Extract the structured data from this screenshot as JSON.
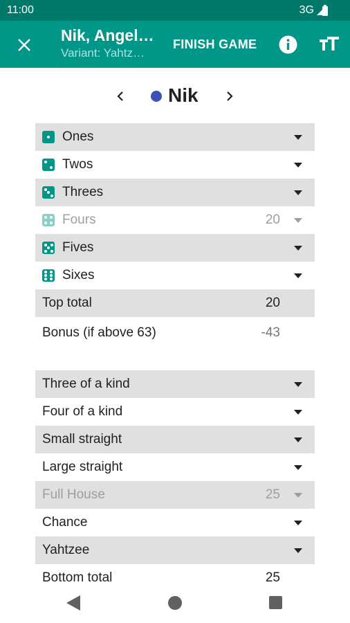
{
  "status_bar": {
    "time": "11:00",
    "network": "3G",
    "signal_icon": "signal-icon",
    "battery_icon": "battery-icon"
  },
  "app_bar": {
    "close_icon": "close-icon",
    "title": "Nik, Angel…",
    "subtitle": "Variant: Yahtz…",
    "finish_label": "FINISH GAME",
    "info_icon": "info-icon",
    "text_size_icon": "text-size-icon",
    "background": "#009688"
  },
  "player": {
    "prev_icon": "chevron-left-icon",
    "next_icon": "chevron-right-icon",
    "name": "Nik",
    "color": "#3f51b5"
  },
  "upper_section": [
    {
      "label": "Ones",
      "die": 1,
      "value": "",
      "dropdown": true,
      "disabled": false,
      "shaded": true
    },
    {
      "label": "Twos",
      "die": 2,
      "value": "",
      "dropdown": true,
      "disabled": false,
      "shaded": false
    },
    {
      "label": "Threes",
      "die": 3,
      "value": "",
      "dropdown": true,
      "disabled": false,
      "shaded": true
    },
    {
      "label": "Fours",
      "die": 4,
      "value": "20",
      "dropdown": true,
      "disabled": true,
      "shaded": false
    },
    {
      "label": "Fives",
      "die": 5,
      "value": "",
      "dropdown": true,
      "disabled": false,
      "shaded": true
    },
    {
      "label": "Sixes",
      "die": 6,
      "value": "",
      "dropdown": true,
      "disabled": false,
      "shaded": false
    }
  ],
  "top_total": {
    "label": "Top total",
    "value": "20"
  },
  "bonus": {
    "label": "Bonus (if above 63)",
    "value": "-43"
  },
  "lower_section": [
    {
      "label": "Three of a kind",
      "value": "",
      "dropdown": true,
      "disabled": false,
      "shaded": true
    },
    {
      "label": "Four of a kind",
      "value": "",
      "dropdown": true,
      "disabled": false,
      "shaded": false
    },
    {
      "label": "Small straight",
      "value": "",
      "dropdown": true,
      "disabled": false,
      "shaded": true
    },
    {
      "label": "Large straight",
      "value": "",
      "dropdown": true,
      "disabled": false,
      "shaded": false
    },
    {
      "label": "Full House",
      "value": "25",
      "dropdown": true,
      "disabled": true,
      "shaded": true
    },
    {
      "label": "Chance",
      "value": "",
      "dropdown": true,
      "disabled": false,
      "shaded": false
    },
    {
      "label": "Yahtzee",
      "value": "",
      "dropdown": true,
      "disabled": false,
      "shaded": true
    }
  ],
  "bottom_total": {
    "label": "Bottom total",
    "value": "25"
  },
  "nav_bar": {
    "back_icon": "back-icon",
    "home_icon": "home-icon",
    "recents_icon": "recents-icon"
  }
}
